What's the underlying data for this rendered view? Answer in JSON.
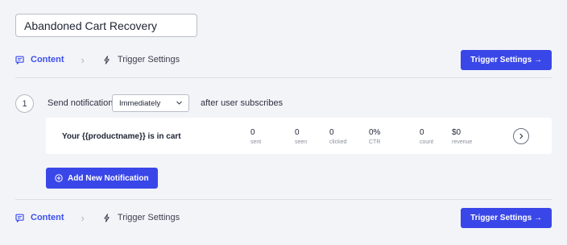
{
  "campaign": {
    "name": "Abandoned Cart Recovery"
  },
  "steps_top": {
    "content_label": "Content",
    "separator": "›",
    "trigger_label": "Trigger Settings"
  },
  "steps_bottom": {
    "content_label": "Content",
    "separator": "›",
    "trigger_label": "Trigger Settings"
  },
  "buttons": {
    "trigger_settings": "Trigger Settings →",
    "add_notification": "Add New Notification"
  },
  "sequence": {
    "step_number": "1",
    "send_label": "Send notification",
    "timing_selected": "Immediately",
    "after_label": "after user subscribes"
  },
  "notification": {
    "title": "Your {{productname}} is in cart",
    "stats": [
      {
        "value": "0",
        "label": "sent"
      },
      {
        "value": "0",
        "label": "seen"
      },
      {
        "value": "0",
        "label": "clicked"
      },
      {
        "value": "0%",
        "label": "CTR"
      },
      {
        "value": "0",
        "label": "count"
      },
      {
        "value": "$0",
        "label": "revenue"
      }
    ]
  },
  "colors": {
    "accent": "#3a47e8",
    "background": "#f3f4f8",
    "card": "#ffffff"
  },
  "icons": {
    "content": "message-square-icon",
    "trigger": "lightning-bolt-icon",
    "add": "plus-circle-icon",
    "open": "chevron-right-circle-icon",
    "dropdown": "chevron-down-icon"
  }
}
